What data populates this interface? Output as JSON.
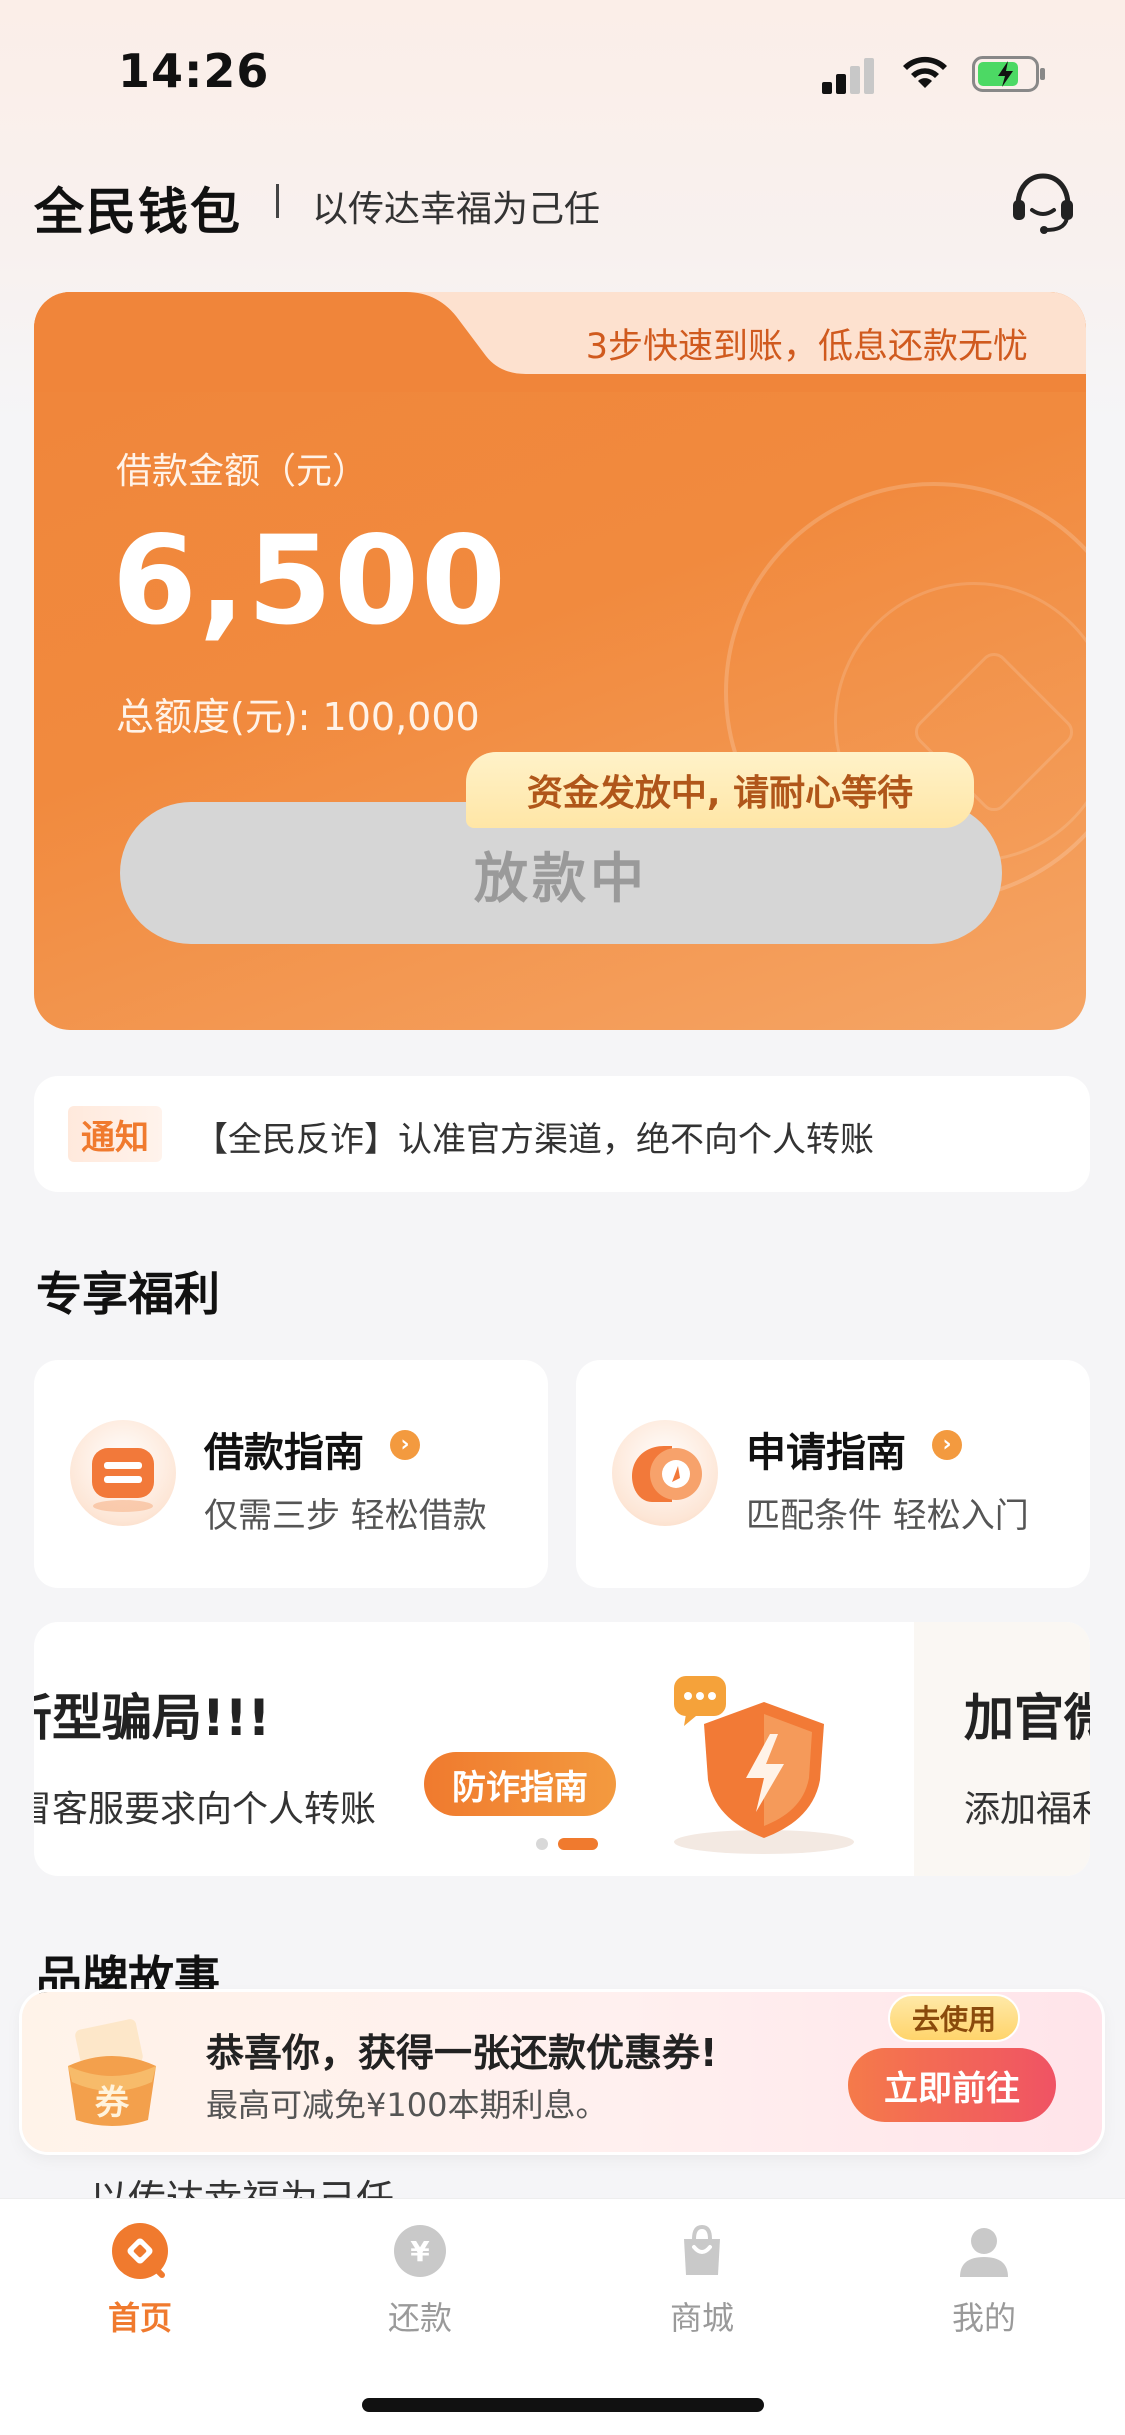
{
  "status_bar": {
    "time": "14:26"
  },
  "header": {
    "brand": "全民钱包",
    "slogan": "以传达幸福为己任"
  },
  "loan_card": {
    "tab_text": "3步快速到账，低息还款无忧",
    "amount_label": "借款金额（元）",
    "amount": "6,500",
    "total_limit": "总额度(元): 100,000",
    "status_tip": "资金发放中, 请耐心等待",
    "status_button": "放款中"
  },
  "notice": {
    "tag": "通知",
    "text": "【全民反诈】认准官方渠道，绝不向个人转账"
  },
  "benefits": {
    "title": "专享福利",
    "items": [
      {
        "title": "借款指南",
        "subtitle": "仅需三步 轻松借款"
      },
      {
        "title": "申请指南",
        "subtitle": "匹配条件 轻松入门"
      }
    ]
  },
  "banner": {
    "title": "新型骗局!!!",
    "subtitle": "冒客服要求向个人转账",
    "button": "防诈指南",
    "next_title": "加官微",
    "next_subtitle": "添加福利"
  },
  "brand_story": {
    "title": "品牌故事",
    "line": "以传达幸福为己任"
  },
  "coupon": {
    "title": "恭喜你，获得一张还款优惠券!",
    "subtitle": "最高可减免¥100本期利息。",
    "icon_text": "券",
    "badge": "去使用",
    "button": "立即前往"
  },
  "tabbar": {
    "items": [
      {
        "label": "首页",
        "icon": "home-icon",
        "active": true
      },
      {
        "label": "还款",
        "icon": "repay-icon",
        "active": false
      },
      {
        "label": "商城",
        "icon": "mall-icon",
        "active": false
      },
      {
        "label": "我的",
        "icon": "profile-icon",
        "active": false
      }
    ]
  },
  "colors": {
    "accent": "#f07a2e",
    "card": "#f18a3e",
    "inactive": "#bdbdbd"
  }
}
